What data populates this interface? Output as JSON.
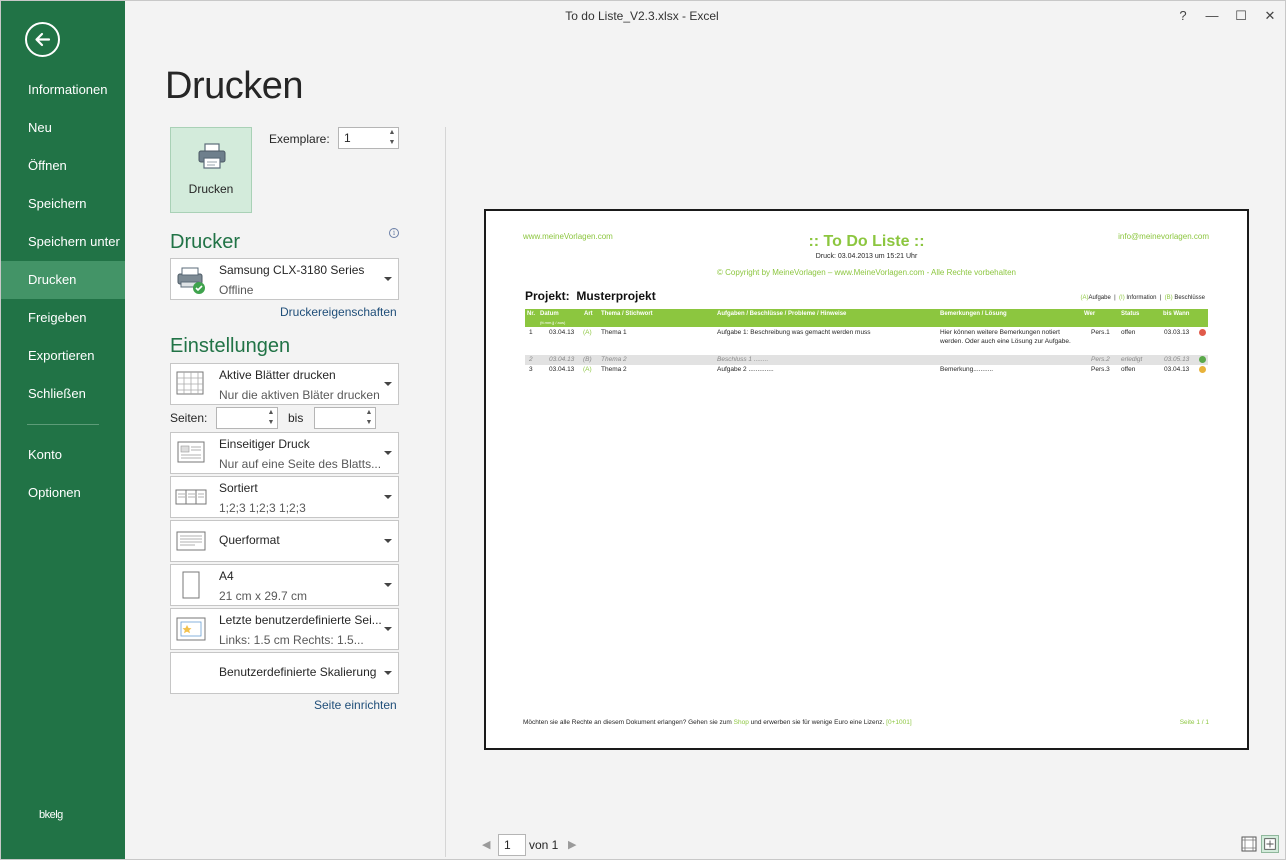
{
  "window": {
    "title": "To do Liste_V2.3.xlsx - Excel",
    "help": "?",
    "minimize": "—",
    "maximize": "☐",
    "close": "✕"
  },
  "sidebar": {
    "back_icon": "arrow-left-circle-icon",
    "items": [
      {
        "label": "Informationen"
      },
      {
        "label": "Neu"
      },
      {
        "label": "Öffnen"
      },
      {
        "label": "Speichern"
      },
      {
        "label": "Speichern unter"
      },
      {
        "label": "Drucken",
        "active": true
      },
      {
        "label": "Freigeben"
      },
      {
        "label": "Exportieren"
      },
      {
        "label": "Schließen"
      },
      {
        "label": "Konto"
      },
      {
        "label": "Optionen"
      }
    ],
    "footer": "bkelg",
    "color": "#217346",
    "active_color": "#439467"
  },
  "print": {
    "title": "Drucken",
    "button_label": "Drucken",
    "copies_label": "Exemplare:",
    "copies_value": "1"
  },
  "printer": {
    "section_title": "Drucker",
    "name": "Samsung CLX-3180 Series",
    "status": "Offline",
    "properties_link": "Druckereigenschaften"
  },
  "settings": {
    "section_title": "Einstellungen",
    "scope": {
      "main": "Aktive Blätter drucken",
      "sub": "Nur die aktiven Bläter drucken"
    },
    "pages_label": "Seiten:",
    "pages_from": "",
    "to_label": "bis",
    "pages_to": "",
    "sides": {
      "main": "Einseitiger Druck",
      "sub": "Nur auf eine Seite des Blatts..."
    },
    "collate": {
      "main": "Sortiert",
      "sub": "1;2;3    1;2;3    1;2;3"
    },
    "orientation": {
      "main": "Querformat"
    },
    "paper": {
      "main": "A4",
      "sub": "21  cm x 29.7  cm"
    },
    "margins": {
      "main": "Letzte benutzerdefinierte Sei...",
      "sub": "Links: 1.5  cm    Rechts: 1.5..."
    },
    "scaling": {
      "main": "Benutzerdefinierte Skalierung"
    },
    "page_setup_link": "Seite einrichten"
  },
  "preview": {
    "site": "www.meineVorlagen.com",
    "email": "info@meinevorlagen.com",
    "title": ":: To Do Liste ::",
    "print_date": "Druck: 03.04.2013 um 15:21 Uhr",
    "copyright": "© Copyright by MeineVorlagen – www.MeineVorlagen.com - Alle Rechte vorbehalten",
    "project_label": "Projekt:",
    "project_name": "Musterprojekt",
    "legend": {
      "a": "(A)",
      "a_label": "Aufgabe",
      "i": "(I)",
      "i_label": "Information",
      "b": "(B)",
      "b_label": "Beschlüsse"
    },
    "columns": [
      "Nr.",
      "Datum",
      "Art",
      "Thema / Stichwort",
      "Aufgaben / Beschlüsse / Probleme / Hinweise",
      "Bemerkungen / Lösung",
      "Wer",
      "Status",
      "bis Wann"
    ],
    "column_sub": "(tt.mm.jj / aus)",
    "rows": [
      {
        "nr": "1",
        "date": "03.04.13",
        "type": "(A)",
        "topic": "Thema 1",
        "task": "Aufgabe 1:  Beschreibung  was gemacht werden muss",
        "note": "Hier können weitere Bemerkungen notiert",
        "note2": "werden. Oder auch eine Lösung zur Aufgabe.",
        "who": "Pers.1",
        "status": "offen",
        "due": "03.03.13",
        "dot_color": "#e05a4a",
        "grey": false
      },
      {
        "nr": "2",
        "date": "03.04.13",
        "type": "(B)",
        "topic": "Thema 2",
        "task": "Beschluss 1 ........",
        "note": "",
        "note2": "",
        "who": "Pers.2",
        "status": "erledigt",
        "due": "03.05.13",
        "dot_color": "#5aa84a",
        "grey": true
      },
      {
        "nr": "3",
        "date": "03.04.13",
        "type": "(A)",
        "topic": "Thema 2",
        "task": "Aufgabe 2 ..............",
        "note": "Bemerkung...........",
        "note2": "",
        "who": "Pers.3",
        "status": "offen",
        "due": "03.04.13",
        "dot_color": "#e8b23a",
        "grey": false
      }
    ],
    "footer_text": "Möchten sie alle Rechte an diesem Dokument erlangen? Gehen sie zum ",
    "footer_shop": "Shop",
    "footer_text2": " und erwerben sie für wenige Euro eine Lizenz. ",
    "footer_code": "[0+1001]",
    "page_number": "Seite 1 / 1",
    "accent": "#8cc63f"
  },
  "pager": {
    "current": "1",
    "total_label": "von 1",
    "prev_icon": "chevron-left-icon",
    "next_icon": "chevron-right-icon"
  },
  "view_buttons": {
    "normal_icon": "show-margins-icon",
    "zoom_icon": "zoom-to-page-icon"
  }
}
